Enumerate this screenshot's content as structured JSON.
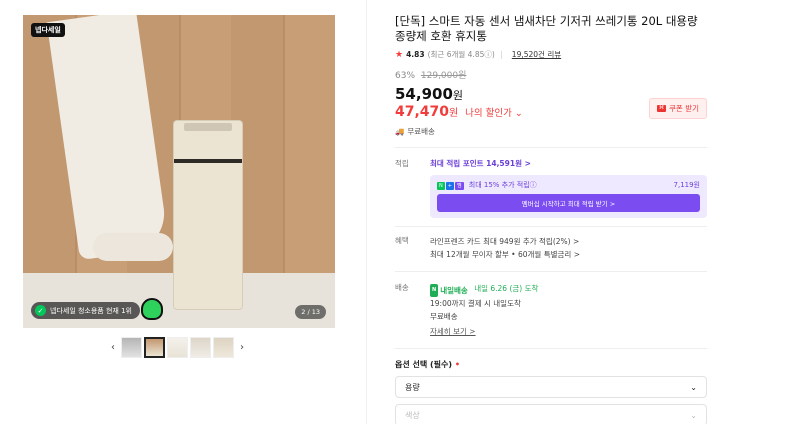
{
  "gallery": {
    "brand_badge": "넵다세일",
    "promo_text": "넵다세일 청소용품 현재 1위",
    "page_counter": "2 / 13",
    "prev_icon": "chevron-left-icon",
    "next_icon": "chevron-right-icon",
    "thumbnail_count": 5
  },
  "product": {
    "title": "[단독] 스마트 자동 센서 냄새차단 기저귀 쓰레기통 20L 대용량 종량제 호환 휴지통",
    "rating": "4.83",
    "rating_sub": "(최근 6개월 4.85ⓘ)",
    "reviews": "19,520건 리뷰",
    "discount_pct": "63%",
    "original_price": "129,000원",
    "price": "54,900",
    "price_unit": "원",
    "my_price": "47,470",
    "my_price_unit": "원",
    "my_price_label": "나의 할인가 ⌄",
    "coupon_label": "쿠폰 받기",
    "free_shipping": "무료배송"
  },
  "points": {
    "label": "적립",
    "max_points": "최대 적립 포인트 14,591원 >",
    "extra_label": "최대 15% 추가 적립ⓘ",
    "extra_points": "7,119원",
    "membership_button": "멤버십 시작하고 최대 적립 받기 >"
  },
  "benefits": {
    "label": "혜택",
    "line1": "라인프렌즈 카드 최대 949원 추가 적립(2%) >",
    "line2": "최대 12개월 무이자 할부 • 60개월 특별금리 >"
  },
  "shipping": {
    "label": "배송",
    "tag": "내일배송",
    "date": "내일 6.26 (금) 도착",
    "cutoff": "19:00까지 결제 시 내일도착",
    "fee": "무료배송",
    "detail_link": "자세히 보기 >"
  },
  "options": {
    "title": "옵션 선택 (필수)",
    "required_mark": "•",
    "capacity_select": "용량",
    "color_select": "색상"
  },
  "colors": {
    "accent_green": "#03c75a",
    "sale_red": "#f03c3c",
    "point_purple": "#6a3fd8"
  }
}
